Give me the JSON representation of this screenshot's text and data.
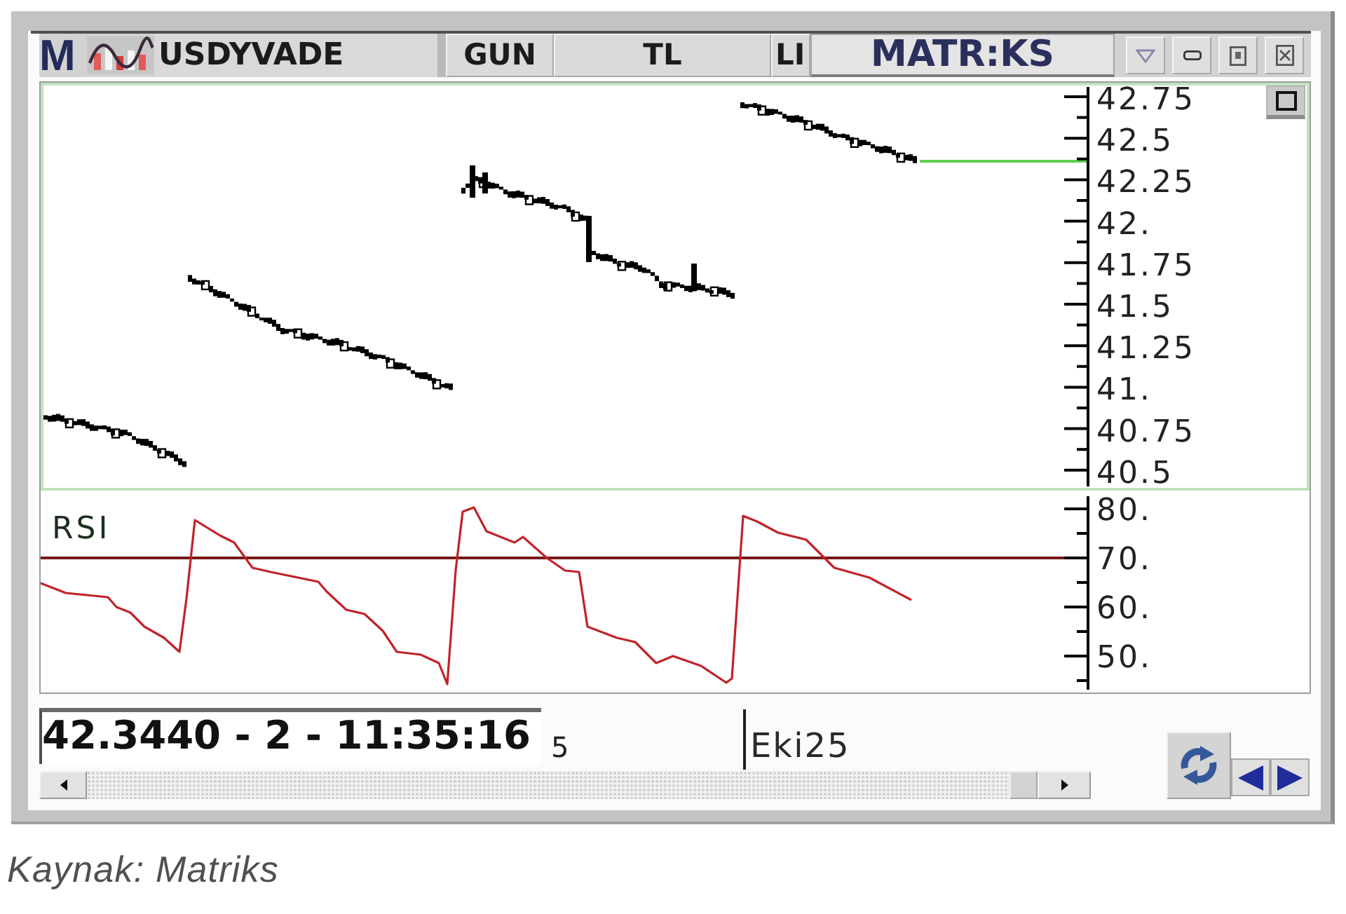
{
  "toolbar": {
    "logo": "M",
    "symbol": "USDYVADE",
    "buttons": [
      "GUN",
      "TL",
      "LI"
    ],
    "brand": "MATR:KS"
  },
  "price_chart": {
    "axis_labels": [
      "42.75",
      "42.5",
      "42.25",
      "42.",
      "41.75",
      "41.5",
      "41.25",
      "41.",
      "40.75",
      "40.5"
    ]
  },
  "rsi_chart": {
    "title": "RSI",
    "axis_labels": [
      "80.",
      "70.",
      "60.",
      "50."
    ]
  },
  "status": {
    "readout": "42.3440 - 2 - 11:35:16",
    "time_label": "5",
    "date_label": "Eki25"
  },
  "caption": "Kaynak: Matriks"
}
